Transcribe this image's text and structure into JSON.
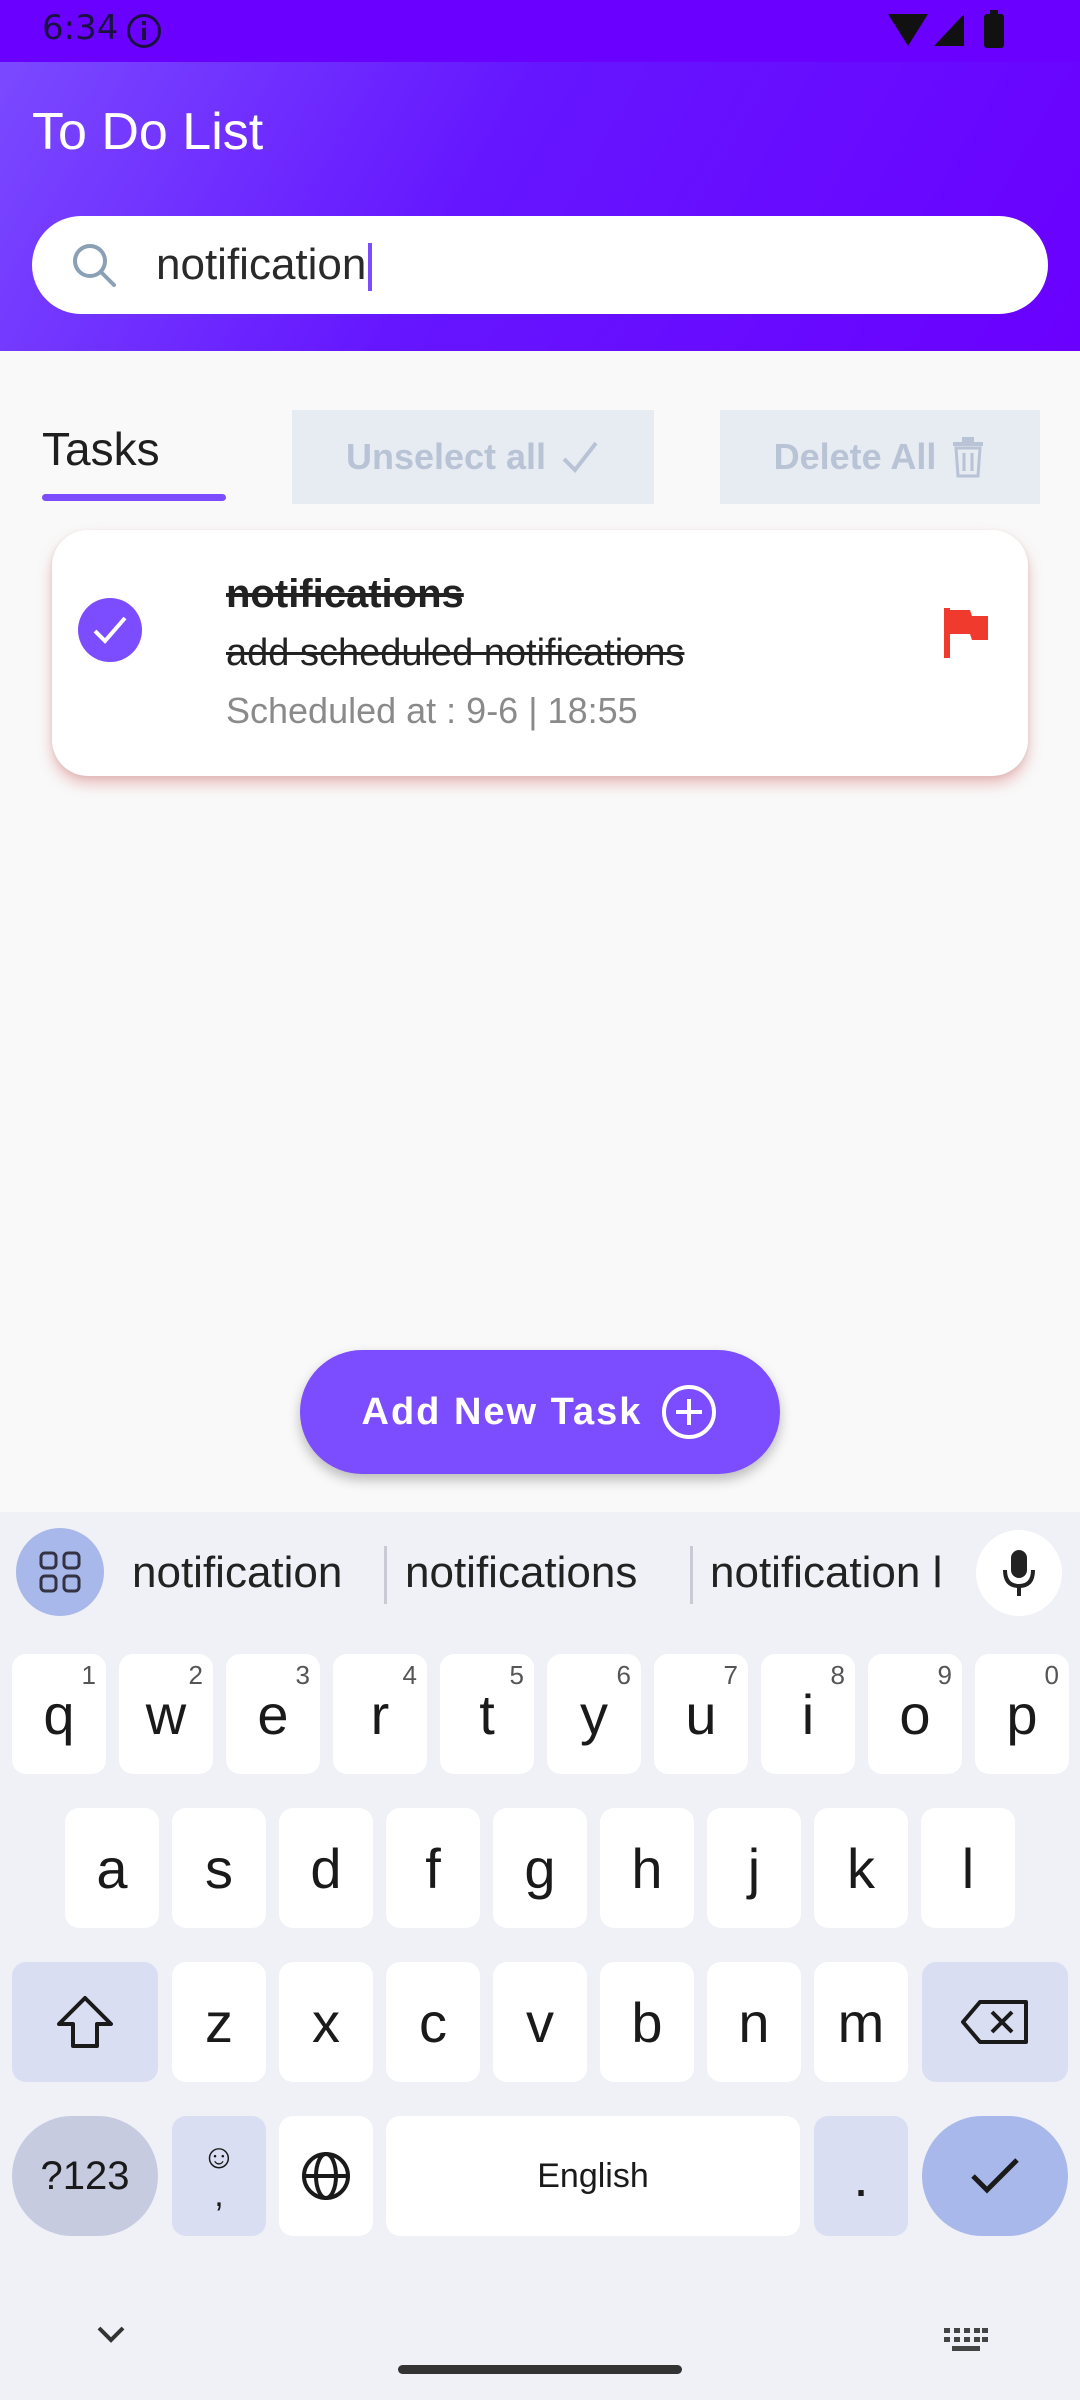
{
  "status_bar": {
    "time": "6:34"
  },
  "app": {
    "title": "To Do List",
    "search": {
      "value": "notification",
      "placeholder": ""
    }
  },
  "toolbar": {
    "tab_label": "Tasks",
    "unselect_label": "Unselect all",
    "delete_label": "Delete All"
  },
  "tasks": [
    {
      "title": "notifications",
      "description": "add scheduled notifications",
      "scheduled": "Scheduled at : 9-6 | 18:55",
      "checked": true,
      "flag_color": "#f03a2e"
    }
  ],
  "add_button": {
    "label": "Add New Task"
  },
  "keyboard": {
    "suggestions": [
      "notification",
      "notifications",
      "notification l"
    ],
    "row1": [
      {
        "k": "q",
        "s": "1"
      },
      {
        "k": "w",
        "s": "2"
      },
      {
        "k": "e",
        "s": "3"
      },
      {
        "k": "r",
        "s": "4"
      },
      {
        "k": "t",
        "s": "5"
      },
      {
        "k": "y",
        "s": "6"
      },
      {
        "k": "u",
        "s": "7"
      },
      {
        "k": "i",
        "s": "8"
      },
      {
        "k": "o",
        "s": "9"
      },
      {
        "k": "p",
        "s": "0"
      }
    ],
    "row2": [
      "a",
      "s",
      "d",
      "f",
      "g",
      "h",
      "j",
      "k",
      "l"
    ],
    "row3": [
      "z",
      "x",
      "c",
      "v",
      "b",
      "n",
      "m"
    ],
    "symbols_label": "?123",
    "emoji_label": "☺",
    "comma_label": ",",
    "space_label": "English",
    "period_label": "."
  },
  "colors": {
    "accent": "#7c4dff",
    "header_dark": "#6a00ff",
    "flag": "#f03a2e"
  },
  "icons": {
    "search": "search-icon",
    "check": "check-icon",
    "trash": "trash-icon",
    "flag": "flag-icon",
    "add": "plus-circle-icon",
    "mic": "mic-icon",
    "grid": "grid-icon"
  }
}
